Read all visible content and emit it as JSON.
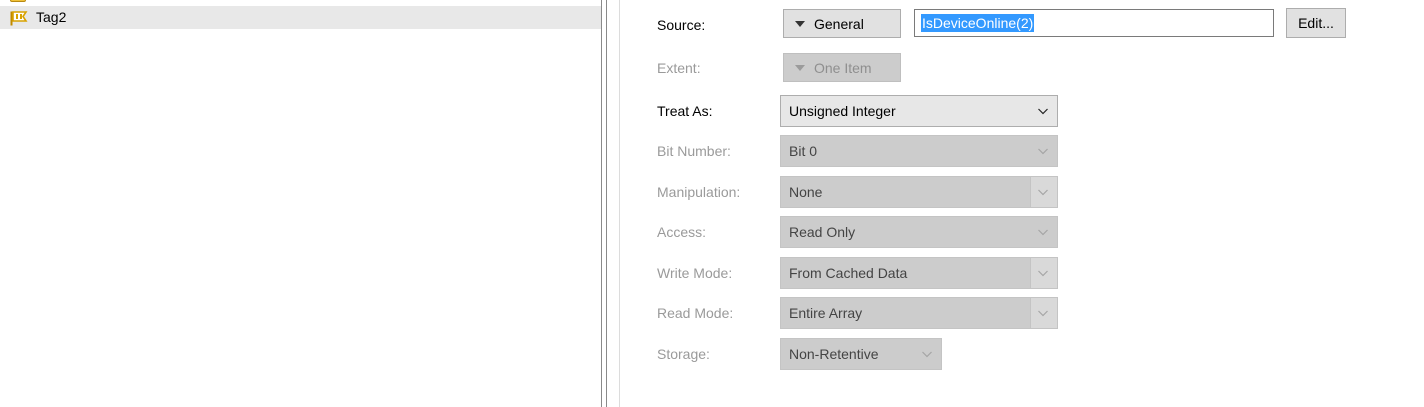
{
  "tree": {
    "items": [
      {
        "label": "Tag2",
        "icon": "tag-icon",
        "selected": true
      }
    ]
  },
  "form": {
    "source": {
      "label": "Source:",
      "button": "General",
      "expression": "IsDeviceOnline(2)",
      "edit_button": "Edit..."
    },
    "extent": {
      "label": "Extent:",
      "button": "One Item"
    },
    "treat_as": {
      "label": "Treat As:",
      "value": "Unsigned Integer"
    },
    "bit_number": {
      "label": "Bit Number:",
      "value": "Bit 0"
    },
    "manipulation": {
      "label": "Manipulation:",
      "value": "None"
    },
    "access": {
      "label": "Access:",
      "value": "Read Only"
    },
    "write_mode": {
      "label": "Write Mode:",
      "value": "From Cached Data"
    },
    "read_mode": {
      "label": "Read Mode:",
      "value": "Entire Array"
    },
    "storage": {
      "label": "Storage:",
      "value": "Non-Retentive"
    }
  },
  "colors": {
    "selection": "#3399ff",
    "disabled_text": "#9a9a9a",
    "tag_icon": "#d8a200"
  }
}
